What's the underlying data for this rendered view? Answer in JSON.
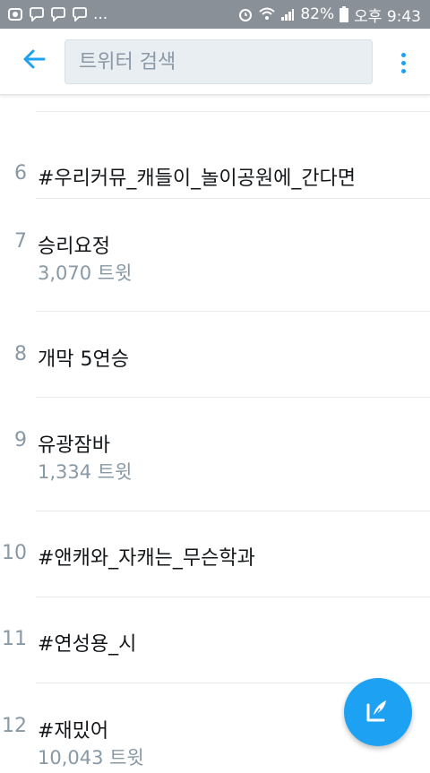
{
  "status_bar": {
    "notification_icons": [
      "photo-icon",
      "chat-bubble-icon",
      "chat-bubble-icon",
      "chat-bubble-icon"
    ],
    "ellipsis": "...",
    "battery_text": "82%",
    "time": "오후 9:43"
  },
  "search": {
    "placeholder": "트위터 검색"
  },
  "trends": [
    {
      "rank": "6",
      "name": "#우리커뮤_캐들이_놀이공원에_간다면",
      "count": ""
    },
    {
      "rank": "7",
      "name": "승리요정",
      "count": "3,070 트윗"
    },
    {
      "rank": "8",
      "name": "개막 5연승",
      "count": ""
    },
    {
      "rank": "9",
      "name": "유광잠바",
      "count": "1,334 트윗"
    },
    {
      "rank": "10",
      "name": "#앤캐와_자캐는_무슨학과",
      "count": ""
    },
    {
      "rank": "11",
      "name": "#연성용_시",
      "count": ""
    },
    {
      "rank": "12",
      "name": "#재밌어",
      "count": "10,043 트윗"
    }
  ],
  "colors": {
    "accent": "#1da1f2",
    "status_bar_bg": "#8a9097",
    "muted_text": "#8899a6",
    "primary_text": "#14171a"
  }
}
